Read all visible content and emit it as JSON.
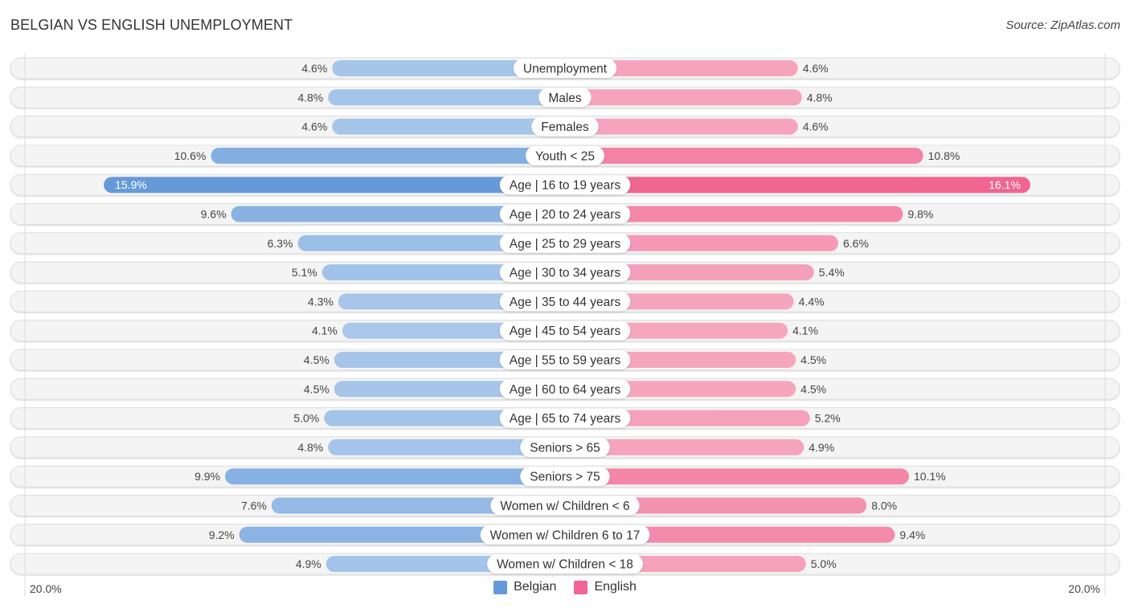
{
  "header": {
    "title": "BELGIAN VS ENGLISH UNEMPLOYMENT",
    "source": "Source: ZipAtlas.com"
  },
  "colors": {
    "belgian_strong": "#6499d9",
    "belgian_light": "#a8c7ea",
    "english_strong": "#f06591",
    "english_light": "#f6a7c0",
    "track": "#f4f4f4",
    "track_border": "#dddddd"
  },
  "legend": [
    {
      "name": "Belgian",
      "color": "#6499d9"
    },
    {
      "name": "English",
      "color": "#f06591"
    }
  ],
  "chart_data": {
    "type": "bar",
    "orientation": "horizontal-diverging",
    "title": "BELGIAN VS ENGLISH UNEMPLOYMENT",
    "xlabel": "",
    "ylabel": "",
    "xlim": [
      -20.0,
      20.0
    ],
    "axis_tick_labels": {
      "left": "20.0%",
      "right": "20.0%"
    },
    "legend_position": "bottom-center",
    "categories": [
      "Unemployment",
      "Males",
      "Females",
      "Youth < 25",
      "Age | 16 to 19 years",
      "Age | 20 to 24 years",
      "Age | 25 to 29 years",
      "Age | 30 to 34 years",
      "Age | 35 to 44 years",
      "Age | 45 to 54 years",
      "Age | 55 to 59 years",
      "Age | 60 to 64 years",
      "Age | 65 to 74 years",
      "Seniors > 65",
      "Seniors > 75",
      "Women w/ Children < 6",
      "Women w/ Children 6 to 17",
      "Women w/ Children < 18"
    ],
    "series": [
      {
        "name": "Belgian",
        "side": "left",
        "values": [
          4.6,
          4.8,
          4.6,
          10.6,
          15.9,
          9.6,
          6.3,
          5.1,
          4.3,
          4.1,
          4.5,
          4.5,
          5.0,
          4.8,
          9.9,
          7.6,
          9.2,
          4.9
        ],
        "labels": [
          "4.6%",
          "4.8%",
          "4.6%",
          "10.6%",
          "15.9%",
          "9.6%",
          "6.3%",
          "5.1%",
          "4.3%",
          "4.1%",
          "4.5%",
          "4.5%",
          "5.0%",
          "4.8%",
          "9.9%",
          "7.6%",
          "9.2%",
          "4.9%"
        ]
      },
      {
        "name": "English",
        "side": "right",
        "values": [
          4.6,
          4.8,
          4.6,
          10.8,
          16.1,
          9.8,
          6.6,
          5.4,
          4.4,
          4.1,
          4.5,
          4.5,
          5.2,
          4.9,
          10.1,
          8.0,
          9.4,
          5.0
        ],
        "labels": [
          "4.6%",
          "4.8%",
          "4.6%",
          "10.8%",
          "16.1%",
          "9.8%",
          "6.6%",
          "5.4%",
          "4.4%",
          "4.1%",
          "4.5%",
          "4.5%",
          "5.2%",
          "4.9%",
          "10.1%",
          "8.0%",
          "9.4%",
          "5.0%"
        ]
      }
    ]
  }
}
